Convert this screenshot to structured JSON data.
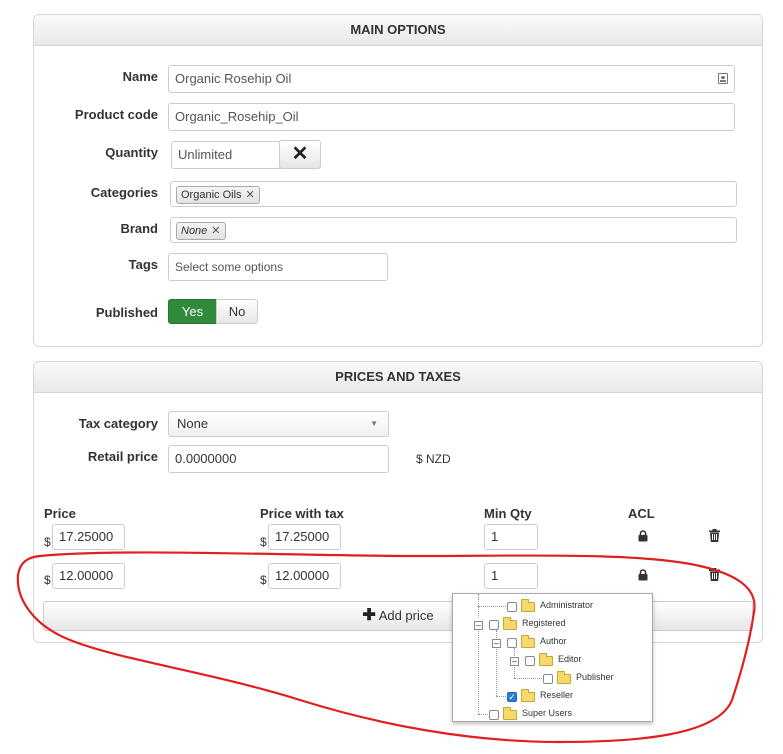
{
  "main_options": {
    "title": "MAIN OPTIONS",
    "name_label": "Name",
    "name_value": "Organic Rosehip Oil",
    "product_code_label": "Product code",
    "product_code_value": "Organic_Rosehip_Oil",
    "quantity_label": "Quantity",
    "quantity_value": "Unlimited",
    "categories_label": "Categories",
    "categories_tags": [
      "Organic Oils"
    ],
    "brand_label": "Brand",
    "brand_tags": [
      "None"
    ],
    "tags_label": "Tags",
    "tags_placeholder": "Select some options",
    "published_label": "Published",
    "published_yes": "Yes",
    "published_no": "No",
    "published_selected": "Yes"
  },
  "prices_taxes": {
    "title": "PRICES AND TAXES",
    "tax_category_label": "Tax category",
    "tax_category_value": "None",
    "retail_price_label": "Retail price",
    "retail_price_value": "0.0000000",
    "currency": "$ NZD",
    "columns": [
      "Price",
      "Price with tax",
      "Min Qty",
      "ACL"
    ],
    "currency_symbol": "$",
    "rows": [
      {
        "price": "17.25000",
        "price_with_tax": "17.25000",
        "min_qty": "1"
      },
      {
        "price": "12.00000",
        "price_with_tax": "12.00000",
        "min_qty": "1"
      }
    ],
    "add_price_label": "Add price"
  },
  "acl_tree": {
    "nodes": [
      {
        "label": "Administrator",
        "checked": false
      },
      {
        "label": "Registered",
        "checked": false
      },
      {
        "label": "Author",
        "checked": false
      },
      {
        "label": "Editor",
        "checked": false
      },
      {
        "label": "Publisher",
        "checked": false
      },
      {
        "label": "Reseller",
        "checked": true
      },
      {
        "label": "Super Users",
        "checked": false
      }
    ]
  },
  "colors": {
    "published_active": "#2f8a3a",
    "annotation_red": "#e02020",
    "checkbox_checked": "#2a7fd4"
  }
}
